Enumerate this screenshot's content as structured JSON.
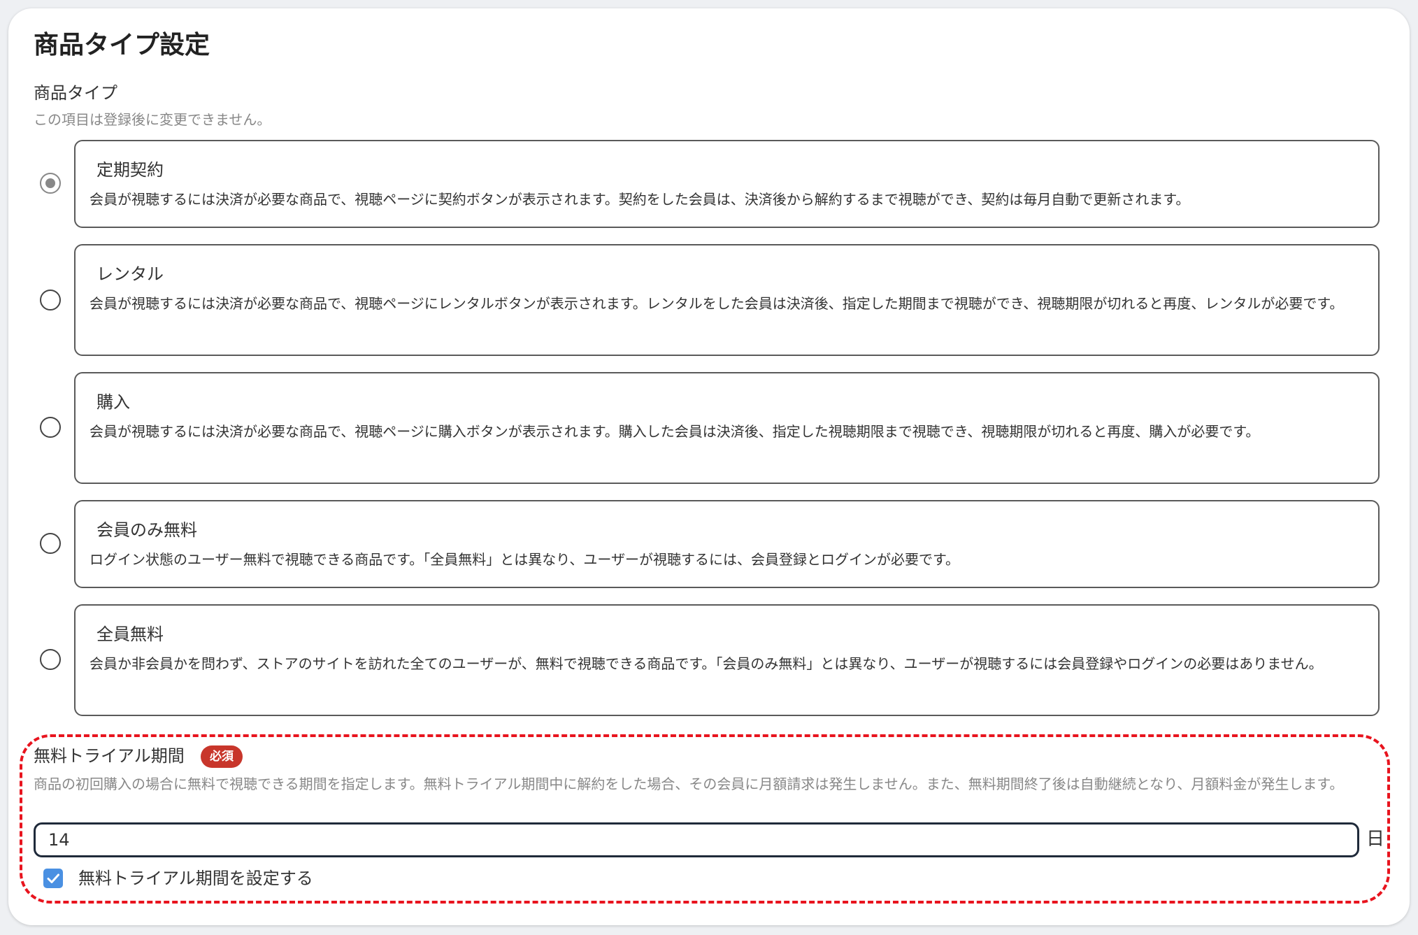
{
  "page_title": "商品タイプ設定",
  "product_type": {
    "label": "商品タイプ",
    "note": "この項目は登録後に変更できません。",
    "selected": "subscription",
    "options": [
      {
        "id": "subscription",
        "title": "定期契約",
        "description": "会員が視聴するには決済が必要な商品で、視聴ページに契約ボタンが表示されます。契約をした会員は、決済後から解約するまで視聴ができ、契約は毎月自動で更新されます。",
        "checked": true
      },
      {
        "id": "rental",
        "title": "レンタル",
        "description": "会員が視聴するには決済が必要な商品で、視聴ページにレンタルボタンが表示されます。レンタルをした会員は決済後、指定した期間まで視聴ができ、視聴期限が切れると再度、レンタルが必要です。",
        "checked": false
      },
      {
        "id": "purchase",
        "title": "購入",
        "description": "会員が視聴するには決済が必要な商品で、視聴ページに購入ボタンが表示されます。購入した会員は決済後、指定した視聴期限まで視聴でき、視聴期限が切れると再度、購入が必要です。",
        "checked": false
      },
      {
        "id": "members_free",
        "title": "会員のみ無料",
        "description": "ログイン状態のユーザー無料で視聴できる商品です。「全員無料」とは異なり、ユーザーが視聴するには、会員登録とログインが必要です。",
        "checked": false
      },
      {
        "id": "all_free",
        "title": "全員無料",
        "description": "会員か非会員かを問わず、ストアのサイトを訪れた全てのユーザーが、無料で視聴できる商品です。「会員のみ無料」とは異なり、ユーザーが視聴するには会員登録やログインの必要はありません。",
        "checked": false
      }
    ]
  },
  "trial": {
    "label": "無料トライアル期間",
    "required_badge": "必須",
    "description": "商品の初回購入の場合に無料で視聴できる期間を指定します。無料トライアル期間中に解約をした場合、その会員に月額請求は発生しません。また、無料期間終了後は自動継続となり、月額料金が発生します。",
    "days_value": "14",
    "days_unit": "日",
    "checkbox_label": "無料トライアル期間を設定する",
    "checkbox_checked": true
  },
  "colors": {
    "required_badge": "#c8362b",
    "checkbox": "#4a90e2",
    "highlight_border": "#e8141e"
  }
}
